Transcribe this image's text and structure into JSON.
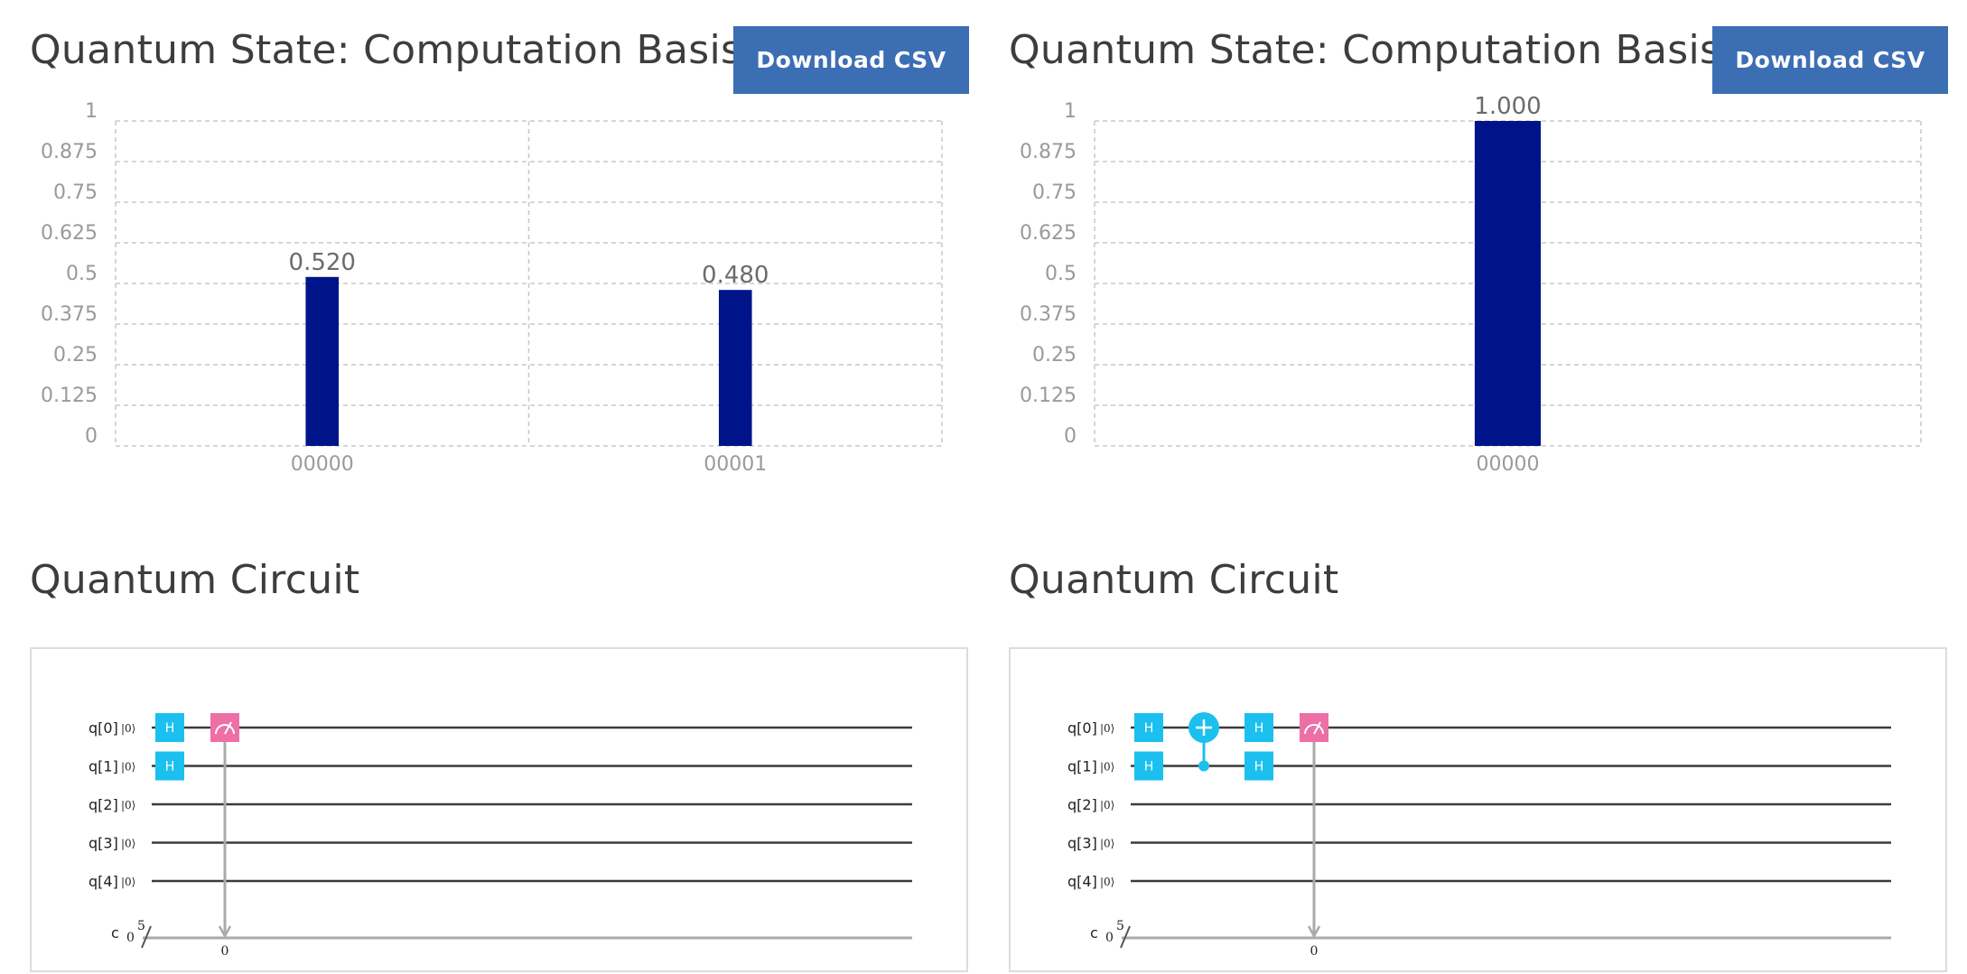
{
  "panels": [
    {
      "state_title": "Quantum State: Computation Basis",
      "download_label": "Download CSV",
      "circuit_title": "Quantum Circuit",
      "chart_data": {
        "type": "bar",
        "title": "Quantum State: Computation Basis",
        "categories": [
          "00000",
          "00001"
        ],
        "values": [
          0.52,
          0.48
        ],
        "value_labels": [
          "0.520",
          "0.480"
        ],
        "yticks": [
          "0",
          "0.125",
          "0.25",
          "0.375",
          "0.5",
          "0.625",
          "0.75",
          "0.875",
          "1"
        ],
        "ylim": [
          0,
          1
        ],
        "xlabel": "",
        "ylabel": "",
        "grid": true,
        "bar_color": "#001489"
      },
      "circuit": {
        "qubits": [
          "q[0]",
          "q[1]",
          "q[2]",
          "q[3]",
          "q[4]"
        ],
        "initial_state": "|0⟩",
        "classical_label": "c",
        "classical_init": "0",
        "classical_size": "5",
        "gates": [
          {
            "type": "H",
            "qubit": 0,
            "step": 0,
            "label": "H"
          },
          {
            "type": "H",
            "qubit": 1,
            "step": 0,
            "label": "H"
          },
          {
            "type": "measure",
            "qubit": 0,
            "step": 1,
            "bit": "0"
          }
        ]
      }
    },
    {
      "state_title": "Quantum State: Computation Basis",
      "download_label": "Download CSV",
      "circuit_title": "Quantum Circuit",
      "chart_data": {
        "type": "bar",
        "title": "Quantum State: Computation Basis",
        "categories": [
          "00000"
        ],
        "values": [
          1.0
        ],
        "value_labels": [
          "1.000"
        ],
        "yticks": [
          "0",
          "0.125",
          "0.25",
          "0.375",
          "0.5",
          "0.625",
          "0.75",
          "0.875",
          "1"
        ],
        "ylim": [
          0,
          1
        ],
        "xlabel": "",
        "ylabel": "",
        "grid": true,
        "bar_color": "#001489"
      },
      "circuit": {
        "qubits": [
          "q[0]",
          "q[1]",
          "q[2]",
          "q[3]",
          "q[4]"
        ],
        "initial_state": "|0⟩",
        "classical_label": "c",
        "classical_init": "0",
        "classical_size": "5",
        "gates": [
          {
            "type": "H",
            "qubit": 0,
            "step": 0,
            "label": "H"
          },
          {
            "type": "H",
            "qubit": 1,
            "step": 0,
            "label": "H"
          },
          {
            "type": "CX",
            "control": 1,
            "target": 0,
            "step": 1
          },
          {
            "type": "H",
            "qubit": 0,
            "step": 2,
            "label": "H"
          },
          {
            "type": "H",
            "qubit": 1,
            "step": 2,
            "label": "H"
          },
          {
            "type": "measure",
            "qubit": 0,
            "step": 3,
            "bit": "0"
          }
        ]
      }
    }
  ],
  "colors": {
    "button": "#3c6eb4",
    "bar": "#001489",
    "gate_h": "#1cc0ee",
    "gate_measure": "#ee6ea6"
  }
}
